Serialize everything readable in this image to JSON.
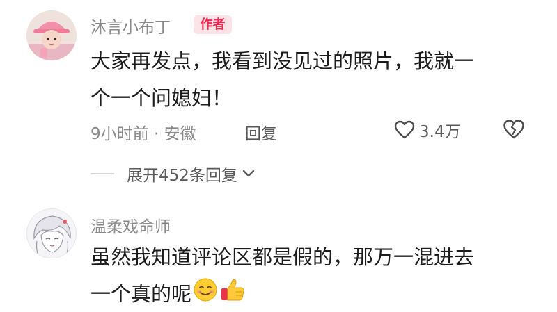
{
  "comments": [
    {
      "username": "沐言小布丁",
      "badge": "作者",
      "text_lines": [
        "大家再发点，我看到没见过的照片，我就一",
        "个一个问媳妇！"
      ],
      "meta": "9小时前 · 安徽",
      "reply_label": "回复",
      "like_count": "3.4万",
      "expand_label": "展开452条回复"
    },
    {
      "username": "温柔戏命师",
      "text_lines": [
        "虽然我知道评论区都是假的，那万一混进去",
        "一个真的呢"
      ],
      "emojis": [
        "smiling-face-emoji",
        "thumbs-up-emoji"
      ]
    }
  ],
  "colors": {
    "username": "#8a8a8a",
    "badge_bg": "#fbe3e8",
    "badge_text": "#f0284f",
    "body_text": "#1c1c1c",
    "secondary_text": "#5a5a5a"
  },
  "icons": {
    "like": "heart-outline-icon",
    "dislike": "broken-heart-icon",
    "expand": "chevron-down-icon"
  }
}
